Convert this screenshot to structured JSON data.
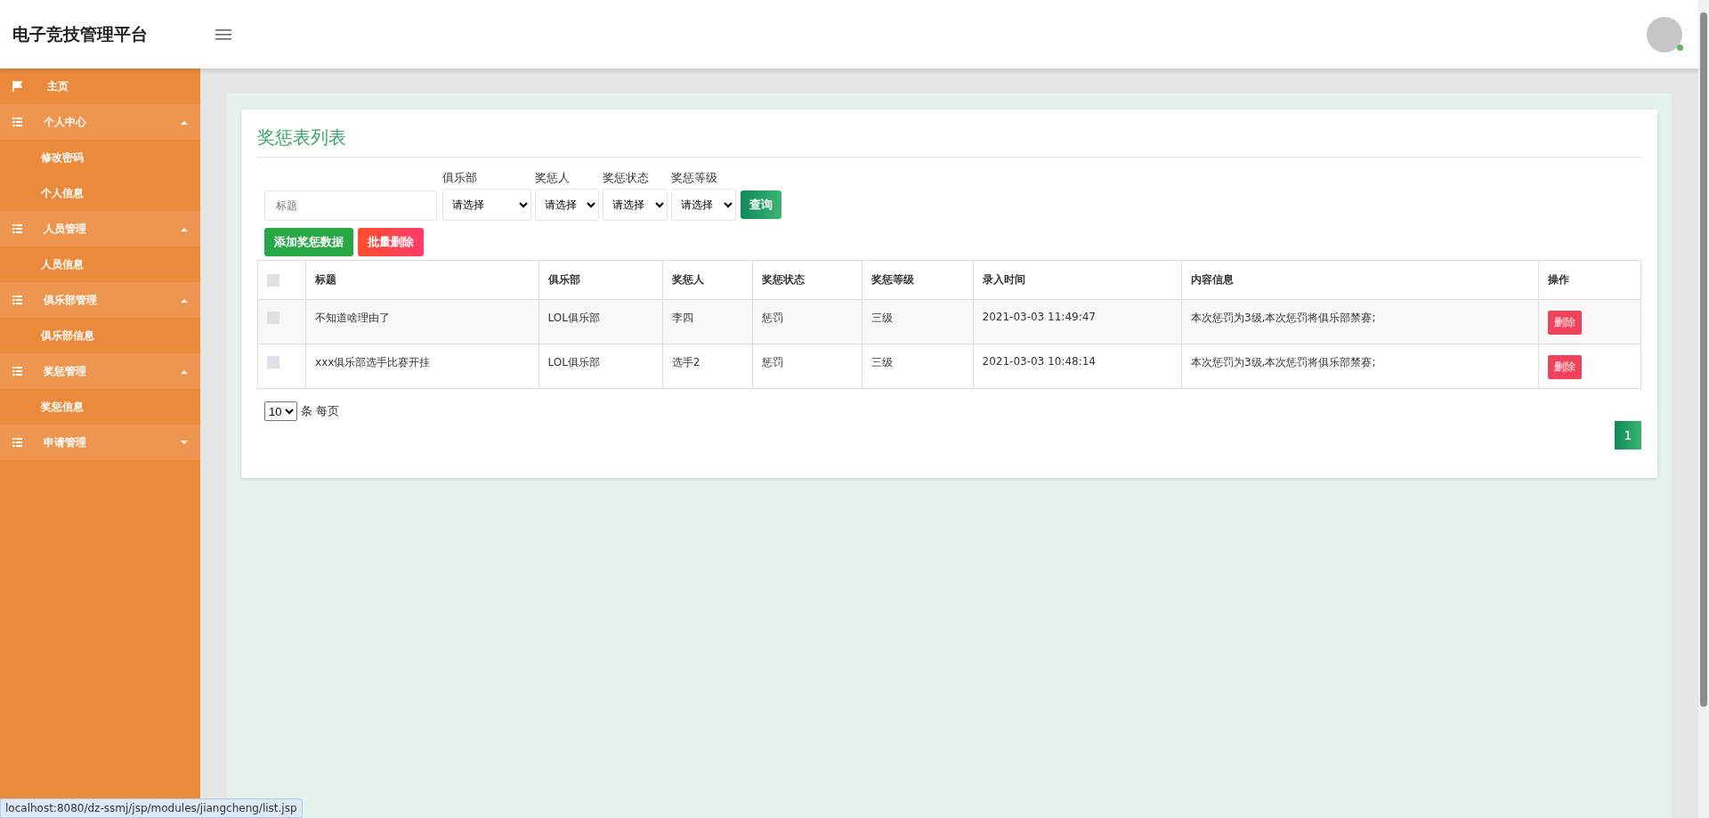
{
  "header": {
    "title": "电子竞技管理平台"
  },
  "sidebar": {
    "items": [
      {
        "label": "主页",
        "kind": "home"
      },
      {
        "label": "个人中心",
        "kind": "group",
        "expanded": true,
        "children": [
          {
            "label": "修改密码"
          },
          {
            "label": "个人信息"
          }
        ]
      },
      {
        "label": "人员管理",
        "kind": "group",
        "expanded": true,
        "children": [
          {
            "label": "人员信息"
          }
        ]
      },
      {
        "label": "俱乐部管理",
        "kind": "group",
        "expanded": true,
        "children": [
          {
            "label": "俱乐部信息"
          }
        ]
      },
      {
        "label": "奖惩管理",
        "kind": "group",
        "expanded": true,
        "children": [
          {
            "label": "奖惩信息"
          }
        ]
      },
      {
        "label": "申请管理",
        "kind": "group",
        "expanded": false
      }
    ]
  },
  "panel": {
    "title": "奖惩表列表",
    "search": {
      "placeholder": "标题"
    },
    "filters": [
      {
        "label": "俱乐部",
        "value": "请选择"
      },
      {
        "label": "奖惩人",
        "value": "请选择"
      },
      {
        "label": "奖惩状态",
        "value": "请选择"
      },
      {
        "label": "奖惩等级",
        "value": "请选择"
      }
    ],
    "query_button": "查询",
    "add_button": "添加奖惩数据",
    "batch_delete_button": "批量删除",
    "table": {
      "header_checked": false,
      "columns": [
        "标题",
        "俱乐部",
        "奖惩人",
        "奖惩状态",
        "奖惩等级",
        "录入时间",
        "内容信息",
        "操作"
      ],
      "rows": [
        {
          "checked": false,
          "cells": [
            "不知道啥理由了",
            "LOL俱乐部",
            "李四",
            "惩罚",
            "三级",
            "2021-03-03 11:49:47",
            "本次惩罚为3级,本次惩罚将俱乐部禁赛;"
          ],
          "action": "删除"
        },
        {
          "checked": false,
          "cells": [
            "xxx俱乐部选手比赛开挂",
            "LOL俱乐部",
            "选手2",
            "惩罚",
            "三级",
            "2021-03-03 10:48:14",
            "本次惩罚为3级,本次惩罚将俱乐部禁赛;"
          ],
          "action": "删除"
        }
      ]
    },
    "page_size": {
      "value": "10",
      "suffix": "条 每页"
    },
    "pages": [
      {
        "label": "1",
        "selected": true
      }
    ]
  },
  "status_bar": {
    "url": "localhost:8080/dz-ssmj/jsp/modules/jiangcheng/list.jsp"
  }
}
